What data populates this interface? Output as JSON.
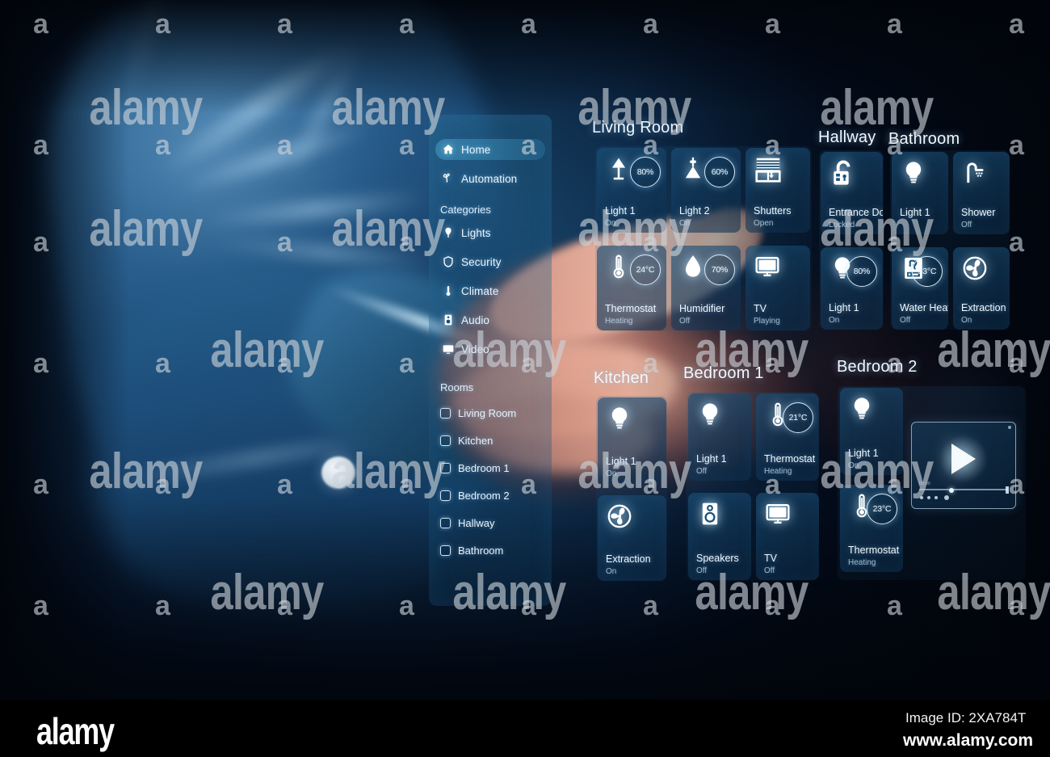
{
  "sidebar": {
    "nav": [
      {
        "label": "Home",
        "icon": "home-icon",
        "active": true
      },
      {
        "label": "Automation",
        "icon": "automation-icon",
        "active": false
      }
    ],
    "categories_heading": "Categories",
    "categories": [
      {
        "label": "Lights",
        "icon": "lightbulb-pin-icon"
      },
      {
        "label": "Security",
        "icon": "shield-icon"
      },
      {
        "label": "Climate",
        "icon": "thermometer-icon"
      },
      {
        "label": "Audio",
        "icon": "speaker-icon"
      },
      {
        "label": "Video",
        "icon": "tv-icon"
      }
    ],
    "rooms_heading": "Rooms",
    "rooms": [
      {
        "label": "Living Room",
        "checked": false
      },
      {
        "label": "Kitchen",
        "checked": false
      },
      {
        "label": "Bedroom 1",
        "checked": false
      },
      {
        "label": "Bedroom 2",
        "checked": false
      },
      {
        "label": "Hallway",
        "checked": false
      },
      {
        "label": "Bathroom",
        "checked": false
      }
    ]
  },
  "sections": {
    "living_room": {
      "title": "Living Room",
      "devices": [
        {
          "name": "Light 1",
          "status": "On",
          "value": "80%",
          "icon": "table-lamp-icon"
        },
        {
          "name": "Light 2",
          "status": "On",
          "value": "60%",
          "icon": "pendant-lamp-icon"
        },
        {
          "name": "Shutters",
          "status": "Open",
          "value": "",
          "icon": "shutters-icon"
        },
        {
          "name": "Thermostat",
          "status": "Heating",
          "value": "24°C",
          "icon": "thermometer-icon"
        },
        {
          "name": "Humidifier",
          "status": "Off",
          "value": "70%",
          "icon": "water-drop-icon"
        },
        {
          "name": "TV",
          "status": "Playing",
          "value": "",
          "icon": "tv-icon"
        }
      ]
    },
    "hallway": {
      "title": "Hallway",
      "devices": [
        {
          "name": "Entrance Door",
          "status": "Locked",
          "value": "",
          "icon": "padlock-icon"
        },
        {
          "name": "Light 1",
          "status": "On",
          "value": "80%",
          "icon": "lightbulb-icon"
        }
      ]
    },
    "bathroom": {
      "title": "Bathroom",
      "devices": [
        {
          "name": "Light 1",
          "status": "",
          "value": "",
          "icon": "lightbulb-icon"
        },
        {
          "name": "Shower",
          "status": "Off",
          "value": "",
          "icon": "shower-icon"
        },
        {
          "name": "Water Heater",
          "status": "Off",
          "value": "53°C",
          "icon": "boiler-icon"
        },
        {
          "name": "Extraction",
          "status": "On",
          "value": "",
          "icon": "fan-icon"
        }
      ]
    },
    "kitchen": {
      "title": "Kitchen",
      "devices": [
        {
          "name": "Light 1",
          "status": "On",
          "value": "",
          "icon": "lightbulb-icon"
        },
        {
          "name": "Extraction",
          "status": "On",
          "value": "",
          "icon": "fan-icon"
        }
      ]
    },
    "bedroom_1": {
      "title": "Bedroom 1",
      "devices": [
        {
          "name": "Light 1",
          "status": "Off",
          "value": "",
          "icon": "lightbulb-icon"
        },
        {
          "name": "Thermostat",
          "status": "Heating",
          "value": "21°C",
          "icon": "thermometer-icon"
        },
        {
          "name": "Speakers",
          "status": "Off",
          "value": "",
          "icon": "speaker-icon"
        },
        {
          "name": "TV",
          "status": "Off",
          "value": "",
          "icon": "tv-icon"
        }
      ]
    },
    "bedroom_2": {
      "title": "Bedroom 2",
      "devices": [
        {
          "name": "Light 1",
          "status": "On",
          "value": "",
          "icon": "lightbulb-icon"
        },
        {
          "name": "Thermostat",
          "status": "Heating",
          "value": "23°C",
          "icon": "thermometer-icon"
        }
      ],
      "media_player": {
        "icon": "play-icon",
        "seek_label": "00:00"
      }
    }
  },
  "watermark": {
    "letter": "a",
    "word": "alamy"
  },
  "footer": {
    "logo": "alamy",
    "image_id": "Image ID: 2XA784T",
    "url": "www.alamy.com"
  },
  "colors": {
    "accent": "#4aa0c8",
    "tile_bg": "#1b5078",
    "text": "#f0f8fd",
    "background": "#030712"
  }
}
